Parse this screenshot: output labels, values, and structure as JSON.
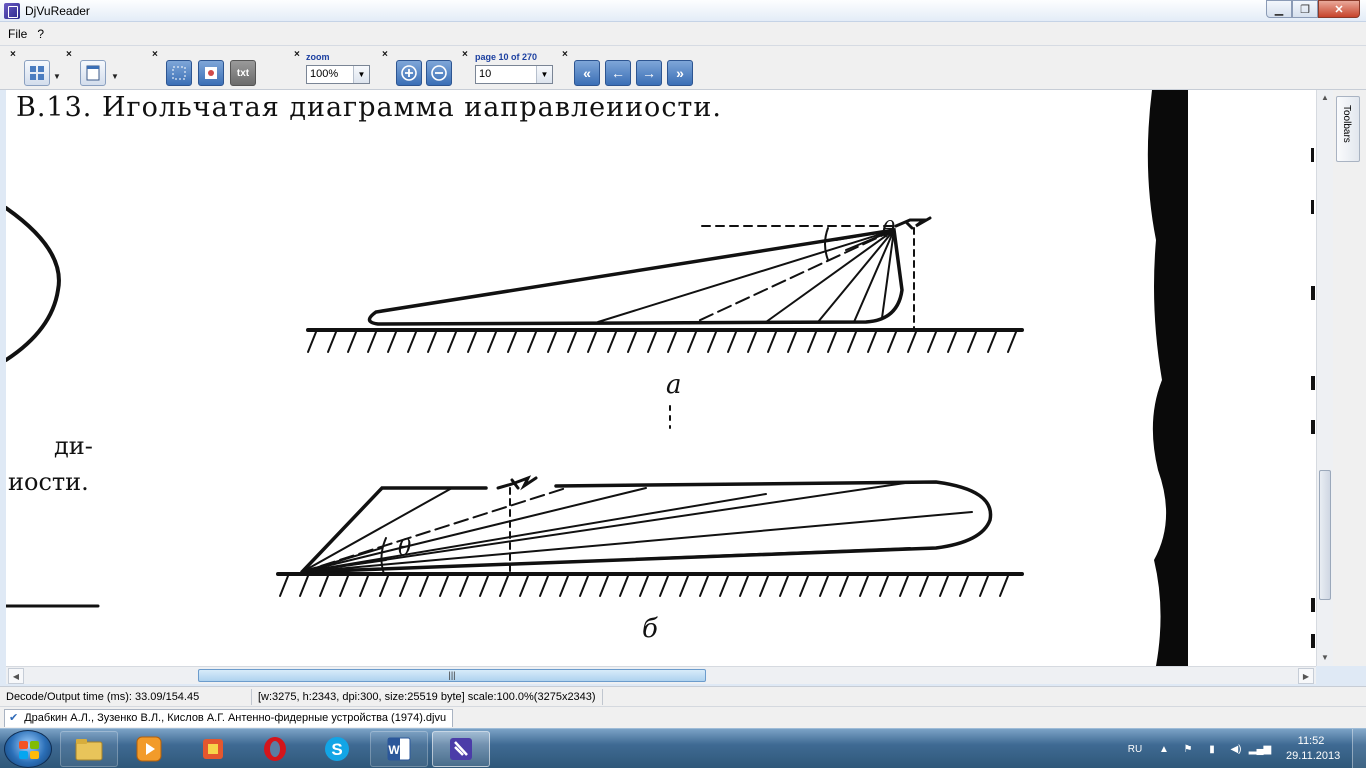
{
  "window": {
    "title": "DjVuReader"
  },
  "menu": {
    "items": [
      "File",
      "?"
    ]
  },
  "toolbar": {
    "zoom_label": "zoom",
    "zoom_value": "100%",
    "page_label": "page 10 of 270",
    "page_value": "10",
    "txt_label": "txt"
  },
  "document": {
    "heading": "В.13. Игольчатая диаграмма иаправлеииости.",
    "side_text_1": "ди-",
    "side_text_2": "иости.",
    "theta": "θ",
    "label_a": "а",
    "label_b": "б"
  },
  "panel": {
    "toolbars_label": "Toolbars"
  },
  "hscroll": {
    "grip": "|||"
  },
  "status": {
    "decode_time": "Decode/Output time (ms): 33.09/154.45",
    "image_info": "[w:3275, h:2343, dpi:300, size:25519 byte] scale:100.0%(3275x2343)"
  },
  "doctab": {
    "filename": "Драбкин А.Л., Зузенко В.Л., Кислов А.Г. Антенно-фидерные устройства (1974).djvu"
  },
  "tray": {
    "lang": "RU"
  },
  "clock": {
    "time": "11:52",
    "date": "29.11.2013"
  }
}
